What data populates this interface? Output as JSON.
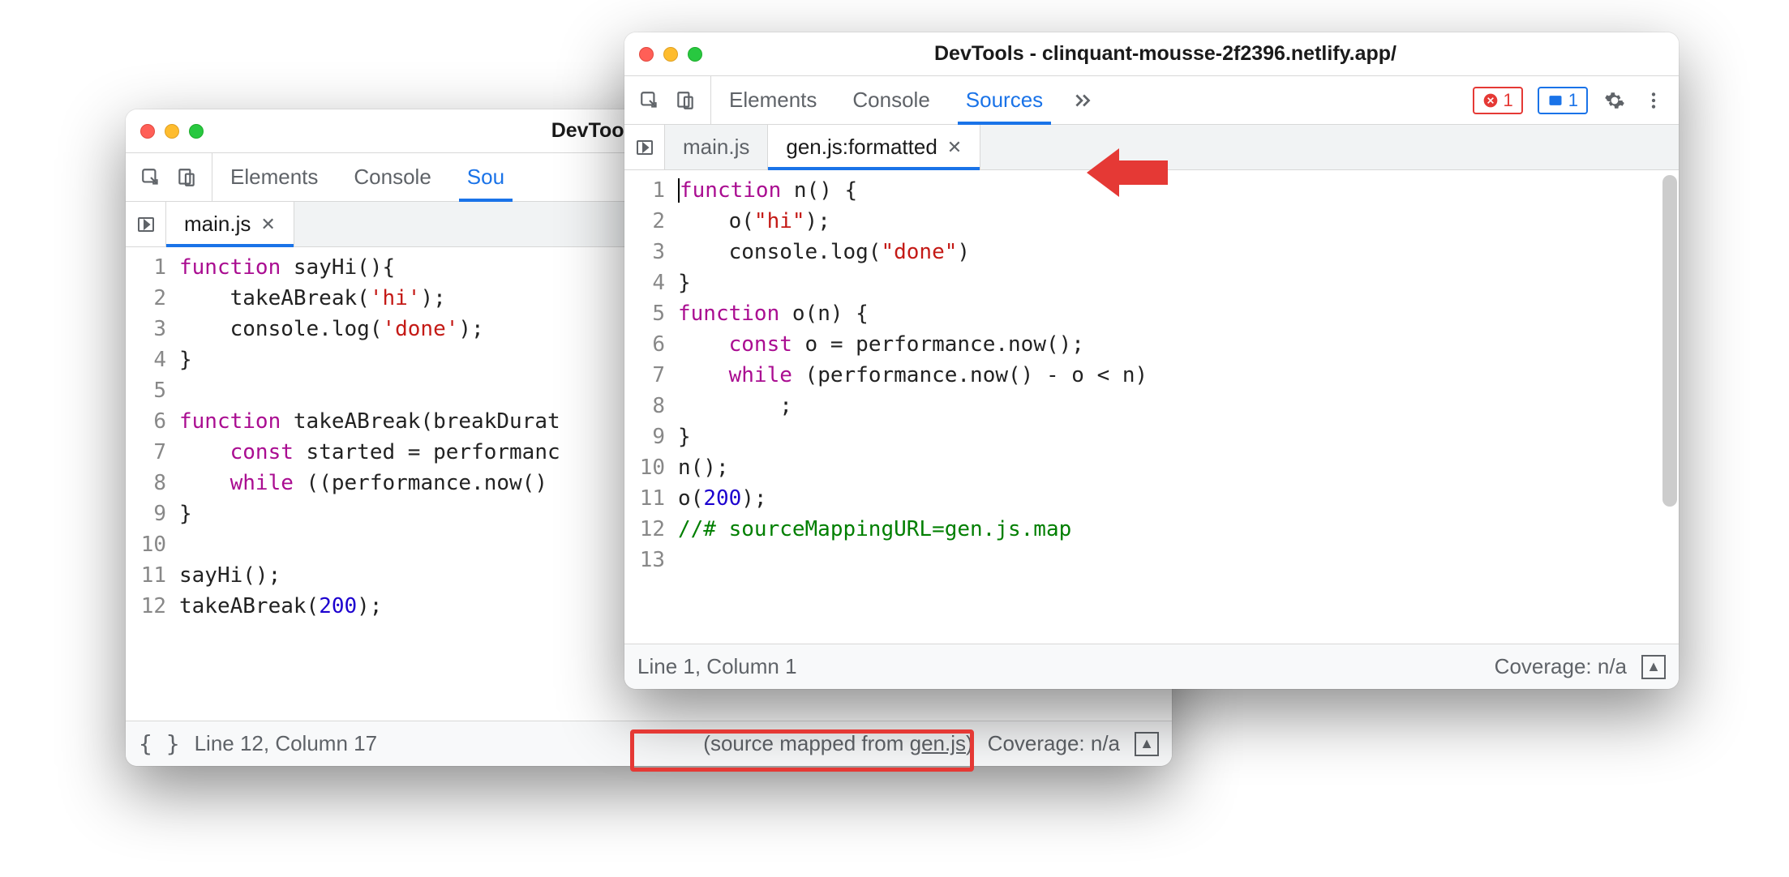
{
  "back": {
    "title": "DevTools - clinquant-m",
    "panels": [
      "Elements",
      "Console",
      "Sou"
    ],
    "activePanel": 2,
    "fileTabs": [
      {
        "label": "main.js",
        "active": true,
        "closable": true
      }
    ],
    "gutter": [
      "1",
      "2",
      "3",
      "4",
      "5",
      "6",
      "7",
      "8",
      "9",
      "10",
      "11",
      "12"
    ],
    "status": {
      "position": "Line 12, Column 17",
      "mapped_prefix": "(source mapped from ",
      "mapped_link": "gen.js",
      "mapped_suffix": ")",
      "coverage": "Coverage: n/a"
    }
  },
  "front": {
    "title": "DevTools - clinquant-mousse-2f2396.netlify.app/",
    "panels": [
      "Elements",
      "Console",
      "Sources"
    ],
    "activePanel": 2,
    "errorCount": "1",
    "infoCount": "1",
    "fileTabs": [
      {
        "label": "main.js",
        "active": false,
        "closable": false
      },
      {
        "label": "gen.js:formatted",
        "active": true,
        "closable": true
      }
    ],
    "gutter": [
      "1",
      "2",
      "3",
      "4",
      "5",
      "6",
      "7",
      "8",
      "9",
      "10",
      "11",
      "12",
      "13"
    ],
    "status": {
      "position": "Line 1, Column 1",
      "coverage": "Coverage: n/a"
    }
  }
}
